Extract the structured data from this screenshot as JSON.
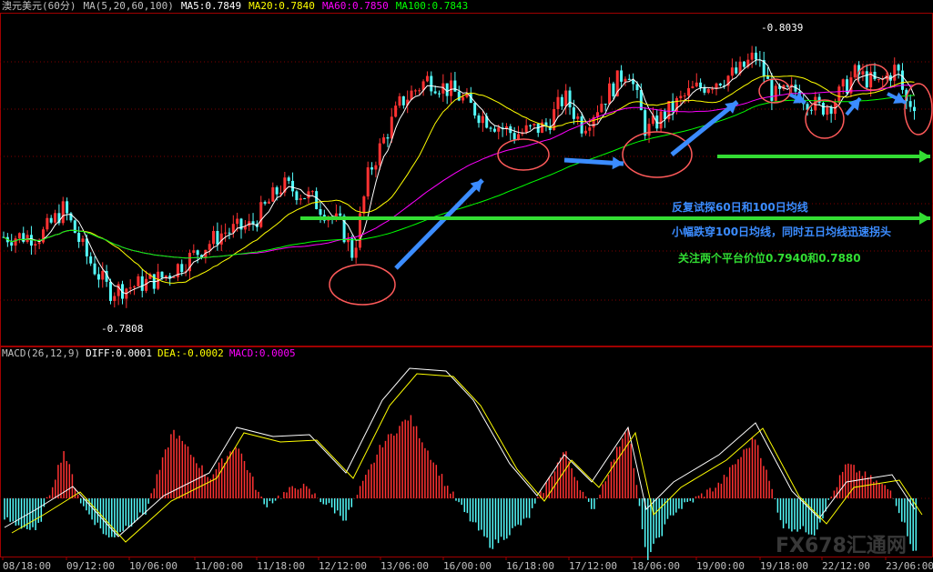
{
  "header": {
    "symbol": "澳元美元(60分)",
    "ma_params": "MA(5,20,60,100)",
    "ma5": "MA5:0.7849",
    "ma20": "MA20:0.7840",
    "ma60": "MA60:0.7850",
    "ma100": "MA100:0.7843"
  },
  "macd_header": {
    "params": "MACD(26,12,9)",
    "diff": "DIFF:0.0001",
    "dea": "DEA:-0.0002",
    "macd": "MACD:0.0005"
  },
  "annotations": {
    "line1": "反复试探60日和100日均线",
    "line2": "小幅跌穿100日均线，同时五日均线迅速拐头",
    "line3": "关注两个平台价位0.7940和0.7880"
  },
  "price_labels": {
    "high": "0.8039",
    "low": "0.7808"
  },
  "watermark": "FX678汇通网",
  "colors": {
    "up": "#ff3232",
    "down": "#54fcfc",
    "ma5": "#ffffff",
    "ma20": "#ffff00",
    "ma60": "#ff00ff",
    "ma100": "#00ff00",
    "annotation_blue": "#3b8cff",
    "annotation_green": "#33dd33"
  },
  "chart_data": {
    "type": "candlestick",
    "x_ticks": [
      "08/18:00",
      "09/12:00",
      "10/06:00",
      "11/00:00",
      "11/18:00",
      "12/12:00",
      "13/06:00",
      "16/00:00",
      "16/18:00",
      "17/12:00",
      "18/06:00",
      "19/00:00",
      "19/18:00",
      "22/12:00",
      "23/06:00"
    ],
    "y_range": [
      0.779,
      0.806
    ],
    "annotations": {
      "high": {
        "x": "19/06:00",
        "value": 0.8039
      },
      "low": {
        "x": "09/18:00",
        "value": 0.7808
      }
    },
    "ma_last": {
      "MA5": 0.7849,
      "MA20": 0.784,
      "MA60": 0.785,
      "MA100": 0.7843
    },
    "macd": {
      "params": [
        26,
        12,
        9
      ],
      "DIFF": 0.0001,
      "DEA": -0.0002,
      "MACD": 0.0005
    }
  }
}
